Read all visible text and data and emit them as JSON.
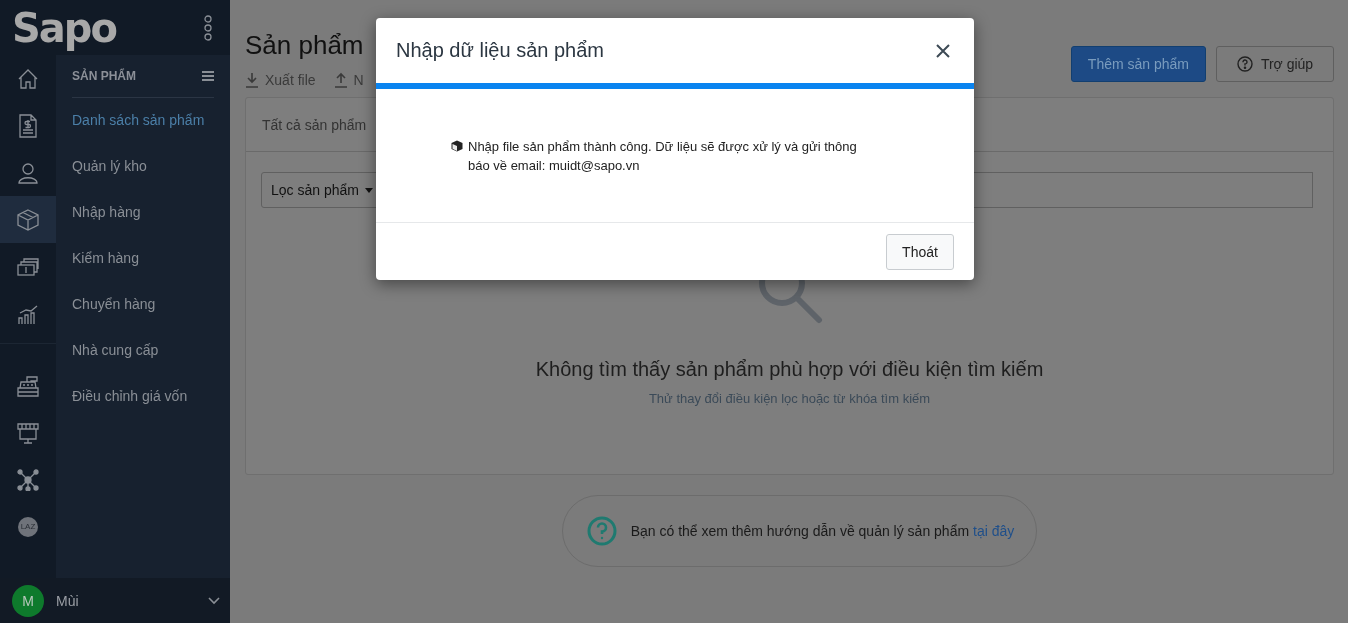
{
  "logo": "Sapo",
  "rail_top": [
    {
      "kind": "home",
      "selected": false
    },
    {
      "kind": "invoice",
      "selected": false
    },
    {
      "kind": "user",
      "selected": false
    },
    {
      "kind": "box",
      "selected": true
    },
    {
      "kind": "cash",
      "selected": false
    },
    {
      "kind": "chart",
      "selected": false
    }
  ],
  "rail_bottom": [
    {
      "kind": "register"
    },
    {
      "kind": "store"
    },
    {
      "kind": "network"
    },
    {
      "kind": "badge",
      "label": "LAZ"
    }
  ],
  "submenu": {
    "title": "SẢN PHẨM",
    "items": [
      {
        "label": "Danh sách sản phẩm",
        "selected": true
      },
      {
        "label": "Quản lý kho",
        "selected": false
      },
      {
        "label": "Nhập hàng",
        "selected": false
      },
      {
        "label": "Kiểm hàng",
        "selected": false
      },
      {
        "label": "Chuyển hàng",
        "selected": false
      },
      {
        "label": "Nhà cung cấp",
        "selected": false
      },
      {
        "label": "Điều chỉnh giá vốn",
        "selected": false
      }
    ]
  },
  "user": {
    "initial": "M",
    "name": "Mùi"
  },
  "page": {
    "title": "Sản phẩm",
    "actions": [
      {
        "kind": "export",
        "label": "Xuất file"
      },
      {
        "kind": "import",
        "label": "N"
      }
    ],
    "buttons": [
      {
        "kind": "primary",
        "label": "Thêm sản phẩm"
      },
      {
        "kind": "help",
        "label": "Trợ giúp"
      }
    ]
  },
  "tab": "Tất cả sản phẩm",
  "filter": "Lọc sản phẩm",
  "empty": {
    "title": "Không tìm thấy sản phẩm phù hợp với điều kiện tìm kiếm",
    "hint": "Thử thay đổi điều kiện lọc hoặc từ khóa tìm kiếm"
  },
  "help": {
    "text": "Bạn có thể xem thêm hướng dẫn về quản lý sản phẩm",
    "link": "tại đây"
  },
  "modal": {
    "title": "Nhập dữ liệu sản phẩm",
    "progress": {
      "level": 1
    },
    "message": "Nhập file sản phẩm thành công. Dữ liệu sẽ được xử lý và gửi thông báo về email: muidt@sapo.vn",
    "button": "Thoát"
  }
}
